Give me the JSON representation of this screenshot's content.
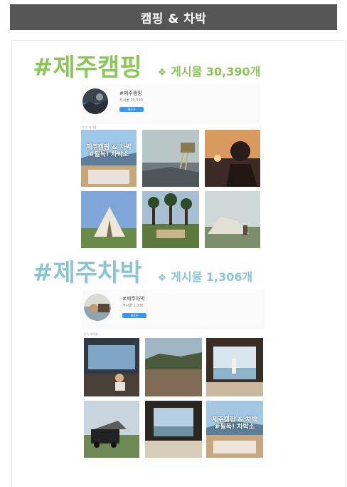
{
  "header": {
    "title": "캠핑 & 차박"
  },
  "sections": [
    {
      "hashtag": "#제주캠핑",
      "posts": "게시물 30,390개",
      "profile": {
        "name": "#제주캠핑",
        "sub": "게시물 30,390",
        "follow": "팔로우",
        "label": "인기 게시물"
      },
      "overlay": [
        "제주캠핑 & 차박",
        "#필독! 차박소"
      ]
    },
    {
      "hashtag": "#제주차박",
      "posts": "게시물 1,306개",
      "profile": {
        "name": "#제주차박",
        "sub": "게시물 1,306",
        "follow": "팔로우",
        "label": "인기 게시물"
      },
      "overlay": [
        "제주캠핑 & 차박",
        "#필독! 차박소"
      ]
    }
  ],
  "colors": {
    "green": "#8bc756",
    "blue": "#8ac6d2",
    "header_bg": "#555555",
    "follow_btn": "#3897f0"
  },
  "icons": {
    "bullet": "diamond-bullet-icon"
  }
}
